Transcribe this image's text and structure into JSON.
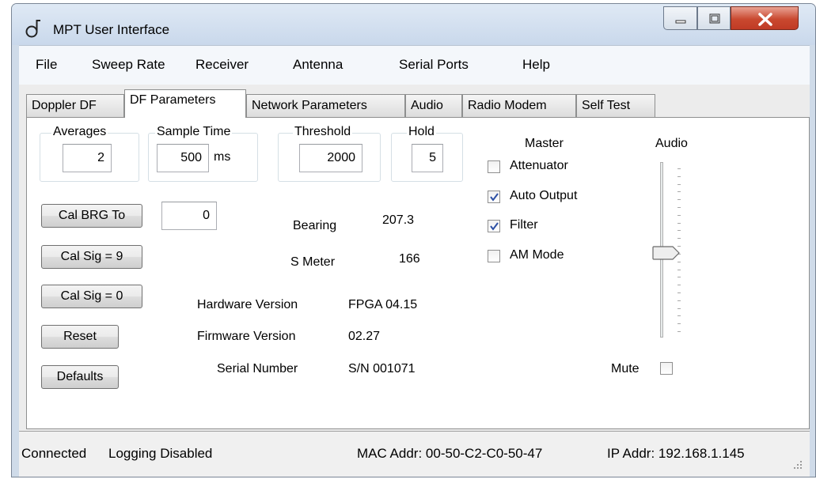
{
  "window": {
    "title": "MPT User Interface"
  },
  "menu": [
    "File",
    "Sweep Rate",
    "Receiver",
    "Antenna",
    "Serial Ports",
    "Help"
  ],
  "tabs": [
    "Doppler DF",
    "DF Parameters",
    "Network Parameters",
    "Audio",
    "Radio Modem",
    "Self Test"
  ],
  "active_tab": "DF Parameters",
  "groups": {
    "averages": {
      "title": "Averages",
      "value": "2"
    },
    "sample_time": {
      "title": "Sample Time",
      "value": "500",
      "unit": "ms"
    },
    "threshold": {
      "title": "Threshold",
      "value": "2000"
    },
    "hold": {
      "title": "Hold",
      "value": "5"
    }
  },
  "buttons": {
    "cal_brg": "Cal BRG To",
    "cal_sig_9": "Cal Sig = 9",
    "cal_sig_0": "Cal Sig = 0",
    "reset": "Reset",
    "defaults": "Defaults"
  },
  "cal_brg_value": "0",
  "readouts": {
    "bearing_label": "Bearing",
    "bearing_value": "207.3",
    "smeter_label": "S Meter",
    "smeter_value": "166",
    "hw_label": "Hardware Version",
    "hw_value": "FPGA 04.15",
    "fw_label": "Firmware Version",
    "fw_value": "02.27",
    "sn_label": "Serial Number",
    "sn_value": "S/N 001071"
  },
  "master": {
    "title": "Master",
    "options": [
      {
        "label": "Attenuator",
        "checked": false
      },
      {
        "label": "Auto Output",
        "checked": true
      },
      {
        "label": "Filter",
        "checked": true
      },
      {
        "label": "AM Mode",
        "checked": false
      }
    ]
  },
  "audio": {
    "title": "Audio",
    "level_fraction": 0.5,
    "mute_label": "Mute",
    "mute_checked": false
  },
  "status": {
    "connection": "Connected",
    "logging": "Logging Disabled",
    "mac": "MAC Addr: 00-50-C2-C0-50-47",
    "ip": "IP Addr: 192.168.1.145"
  },
  "colors": {
    "title_bar": "#cfdbe9",
    "close_button": "#c9482f",
    "panel": "#ffffff",
    "checkmark": "#2c4fa4"
  },
  "icons": [
    "app-logo-icon",
    "minimize-icon",
    "maximize-icon",
    "close-icon",
    "check-icon",
    "slider-thumb-icon",
    "resize-grip-icon"
  ]
}
